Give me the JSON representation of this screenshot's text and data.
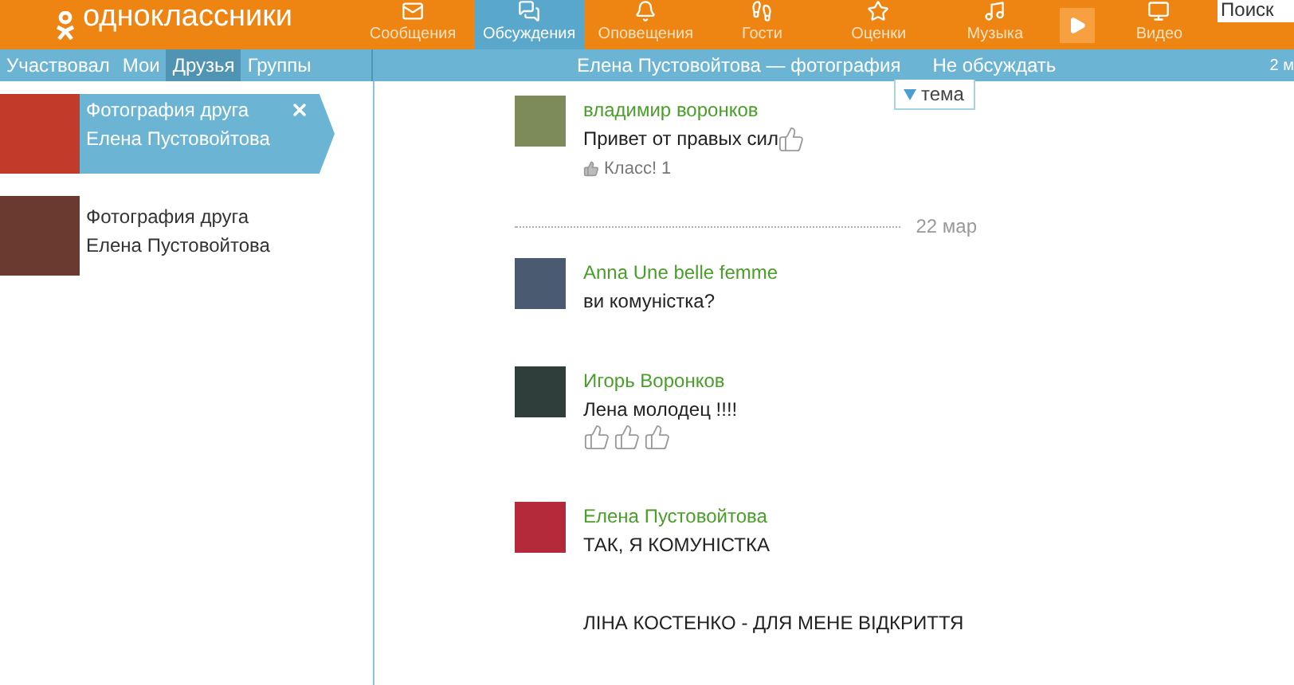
{
  "header": {
    "logo": "одноклассники",
    "nav": [
      {
        "label": "Сообщения",
        "selected": false
      },
      {
        "label": "Обсуждения",
        "selected": true
      },
      {
        "label": "Оповещения",
        "selected": false
      },
      {
        "label": "Гости",
        "selected": false
      },
      {
        "label": "Оценки",
        "selected": false
      },
      {
        "label": "Музыка",
        "selected": false
      },
      {
        "label": "Видео",
        "selected": false
      }
    ],
    "search": {
      "placeholder": "Поиск"
    }
  },
  "subnav": {
    "filters": [
      {
        "label": "Участвовал",
        "selected": false
      },
      {
        "label": "Мои",
        "selected": false
      },
      {
        "label": "Друзья",
        "selected": true
      },
      {
        "label": "Группы",
        "selected": false
      }
    ],
    "title": "Елена Пустовойтова — фотография",
    "action": "Не обсуждать",
    "date": "2 м"
  },
  "threads": [
    {
      "title": "Фотография друга",
      "author": "Елена Пустовойтова",
      "selected": true
    },
    {
      "title": "Фотография друга",
      "author": "Елена Пустовойтова",
      "selected": false
    }
  ],
  "topic_tab": {
    "label": "тема"
  },
  "feed": [
    {
      "kind": "message",
      "author": "владимир воронков",
      "paragraphs": [
        [
          [
            {
              "kind": "text",
              "text": "Привет от правых сил"
            },
            {
              "kind": "thumb"
            }
          ]
        ]
      ],
      "likes": "Класс! 1"
    },
    {
      "kind": "date",
      "text": "22 мар"
    },
    {
      "kind": "message",
      "author": "Anna Une belle femme",
      "paragraphs": [
        [
          [
            {
              "kind": "text",
              "text": "ви комуністка?"
            }
          ]
        ]
      ]
    },
    {
      "kind": "message",
      "author": "Игорь Воронков",
      "paragraphs": [
        [
          [
            {
              "kind": "text",
              "text": "Лена молодец !!!!"
            }
          ],
          [
            {
              "kind": "thumb"
            },
            {
              "kind": "thumb"
            },
            {
              "kind": "thumb"
            }
          ]
        ]
      ]
    },
    {
      "kind": "message",
      "author": "Елена Пустовойтова",
      "paragraphs": [
        [
          [
            {
              "kind": "text",
              "text": "ТАК, Я КОМУНІСТКА"
            }
          ]
        ],
        [
          [
            {
              "kind": "text",
              "text": "ЛІНА КОСТЕНКО - ДЛЯ МЕНЕ ВІДКРИТТЯ"
            }
          ]
        ]
      ]
    }
  ]
}
